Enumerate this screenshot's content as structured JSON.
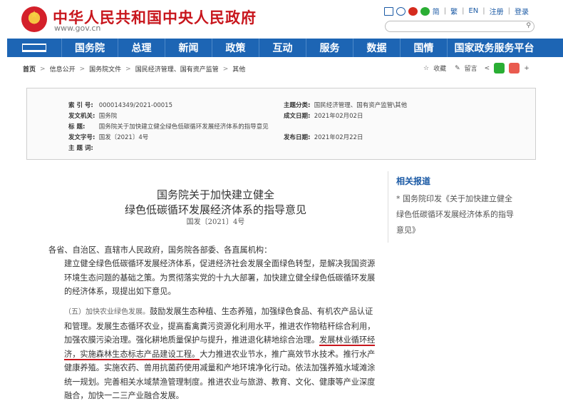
{
  "header": {
    "site_title": "中华人民共和国中央人民政府",
    "site_url": "www.gov.cn",
    "links": [
      "简",
      "繁",
      "EN",
      "注册",
      "登录"
    ],
    "search_placeholder": "",
    "search_icon": "search-icon"
  },
  "nav": {
    "items": [
      "国务院",
      "总理",
      "新闻",
      "政策",
      "互动",
      "服务",
      "数据",
      "国情",
      "国家政务服务平台"
    ]
  },
  "breadcrumb": [
    "首页",
    "信息公开",
    "国务院文件",
    "国民经济管理、国有资产监管",
    "其他"
  ],
  "tools": {
    "favorite": "收藏",
    "comment": "留言"
  },
  "info": {
    "index_label": "索 引 号:",
    "index_value": "000014349/2021-00015",
    "category_label": "主题分类:",
    "category_value": "国民经济管理、国有资产监管\\其他",
    "issuer_label": "发文机关:",
    "issuer_value": "国务院",
    "date_label": "成文日期:",
    "date_value": "2021年02月02日",
    "title_label": "标 题:",
    "title_value": "国务院关于加快建立健全绿色低碳循环发展经济体系的指导意见",
    "docnum_label": "发文字号:",
    "docnum_value": "国发〔2021〕4号",
    "pubdate_label": "发布日期:",
    "pubdate_value": "2021年02月22日",
    "subject_label": "主 题 词:",
    "subject_value": ""
  },
  "article": {
    "title_line1": "国务院关于加快建立健全",
    "title_line2": "绿色低碳循环发展经济体系的指导意见",
    "doc_number": "国发〔2021〕4号",
    "salutation": "各省、自治区、直辖市人民政府，国务院各部委、各直属机构：",
    "intro": "建立健全绿色低碳循环发展经济体系，促进经济社会发展全面绿色转型，是解决我国资源环境生态问题的基础之策。为贯彻落实党的十九大部署，加快建立健全绿色低碳循环发展的经济体系，现提出如下意见。",
    "p5_heading": "（五）加快农业绿色发展。",
    "p5_a": "鼓励发展生态种植、生态养殖，加强绿色食品、有机农产品认证和管理。发展生态循环农业，提高畜禽粪污资源化利用水平，推进农作物秸秆综合利用，加强农膜污染治理。强化耕地质量保护与提升，推进退化耕地综合治理。",
    "p5_underlined": "发展林业循环经济，实施森林生态标志产品建设工程。",
    "p5_b": "大力推进农业节水，推广高效节水技术。推行水产健康养殖。实施农药、兽用抗菌药使用减量和产地环境净化行动。依法加强养殖水域滩涂统一规划。完善相关水域禁渔管理制度。推进农业与旅游、教育、文化、健康等产业深度融合，加快一二三产业融合发展。"
  },
  "side": {
    "title": "相关报道",
    "link": "国务院印发《关于加快建立健全绿色低碳循环发展经济体系的指导意见》"
  }
}
